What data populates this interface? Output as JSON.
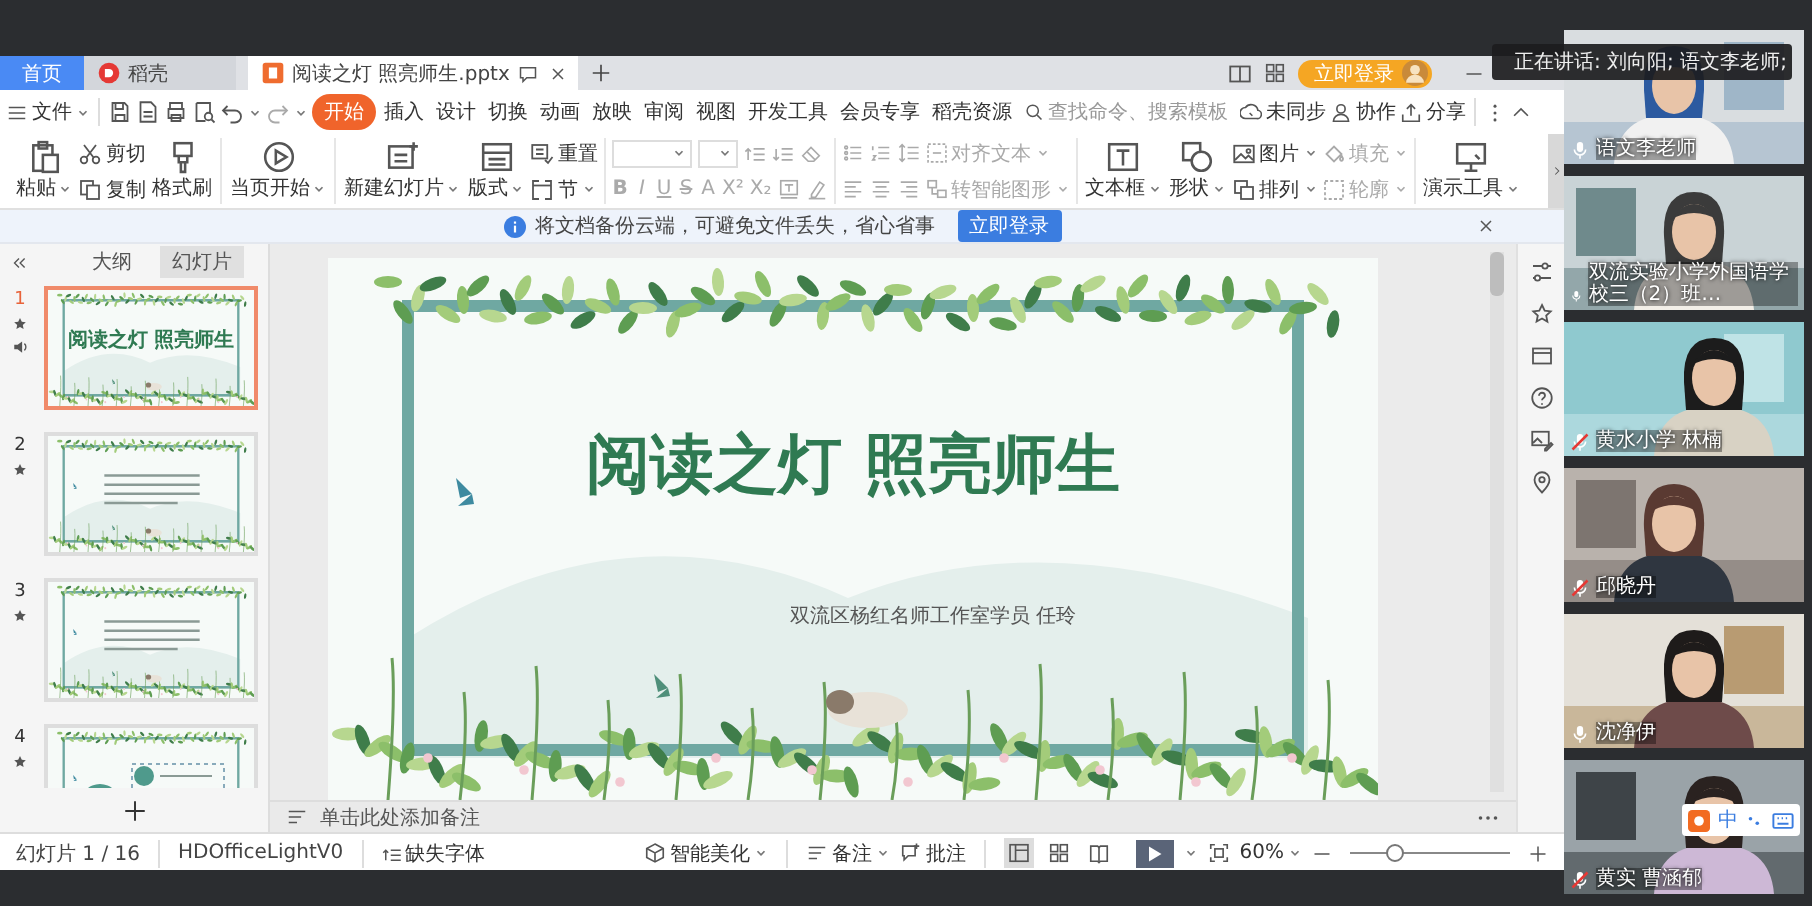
{
  "app_tabs": [
    {
      "label": "首页",
      "kind": "home",
      "selected": false
    },
    {
      "label": "稻壳",
      "kind": "store",
      "selected": false
    },
    {
      "label": "阅读之灯 照亮师生.pptx",
      "kind": "document",
      "selected": true
    }
  ],
  "account": {
    "login": "立即登录"
  },
  "menu": {
    "file": "文件",
    "tabs": [
      {
        "label": "开始",
        "selected": true
      },
      {
        "label": "插入",
        "selected": false
      },
      {
        "label": "设计",
        "selected": false
      },
      {
        "label": "切换",
        "selected": false
      },
      {
        "label": "动画",
        "selected": false
      },
      {
        "label": "放映",
        "selected": false
      },
      {
        "label": "审阅",
        "selected": false
      },
      {
        "label": "视图",
        "selected": false
      },
      {
        "label": "开发工具",
        "selected": false
      },
      {
        "label": "会员专享",
        "selected": false
      },
      {
        "label": "稻壳资源",
        "selected": false
      }
    ],
    "search": {
      "placeholder": "查找命令、搜索模板"
    },
    "actions": [
      {
        "label": "未同步",
        "kind": "sync"
      },
      {
        "label": "协作",
        "kind": "collab"
      },
      {
        "label": "分享",
        "kind": "share"
      }
    ]
  },
  "ribbon": [
    {
      "columns": [
        {
          "kind": "large",
          "label": "粘贴",
          "dropdown": true
        },
        {
          "kind": "stack",
          "items": [
            {
              "label": "剪切"
            },
            {
              "label": "复制"
            }
          ]
        },
        {
          "kind": "large",
          "label": "格式刷"
        }
      ]
    },
    {
      "columns": [
        {
          "kind": "large",
          "label": "当页开始",
          "dropdown": true
        }
      ]
    },
    {
      "columns": [
        {
          "kind": "large",
          "label": "新建幻灯片",
          "dropdown": true
        },
        {
          "kind": "large",
          "label": "版式",
          "dropdown": true
        },
        {
          "kind": "stack",
          "items": [
            {
              "label": "重置"
            },
            {
              "label": "节",
              "dropdown": true
            }
          ]
        }
      ]
    },
    {
      "columns": [
        {
          "kind": "font",
          "glyphs": [
            "B",
            "I",
            "U",
            "S",
            "A",
            "X²",
            "X₂"
          ]
        }
      ]
    },
    {
      "columns": [
        {
          "kind": "paragraph",
          "labels": [
            {
              "label": "对齐文本",
              "disabled": true
            },
            {
              "label": "转智能图形",
              "disabled": true
            }
          ]
        }
      ]
    },
    {
      "columns": [
        {
          "kind": "large",
          "label": "文本框",
          "dropdown": true
        },
        {
          "kind": "large",
          "label": "形状",
          "dropdown": true
        },
        {
          "kind": "stack",
          "items": [
            {
              "label": "图片",
              "dropdown": true
            },
            {
              "label": "排列",
              "dropdown": true
            }
          ]
        },
        {
          "kind": "stack",
          "items": [
            {
              "label": "填充",
              "dropdown": true,
              "disabled": true
            },
            {
              "label": "轮廓",
              "dropdown": true,
              "disabled": true
            }
          ]
        }
      ]
    },
    {
      "columns": [
        {
          "kind": "large",
          "label": "演示工具",
          "dropdown": true
        }
      ]
    }
  ],
  "notice": {
    "text": "将文档备份云端，可避免文件丢失，省心省事",
    "button": "立即登录"
  },
  "panel": {
    "tabs": [
      {
        "label": "大纲",
        "selected": false
      },
      {
        "label": "幻灯片",
        "selected": true
      }
    ],
    "slides": [
      {
        "number": "1",
        "kind": "title",
        "title": "阅读之灯 照亮师生",
        "selected": true,
        "audio": true
      },
      {
        "number": "2",
        "kind": "text",
        "selected": false,
        "audio": false
      },
      {
        "number": "3",
        "kind": "text",
        "selected": false,
        "audio": false
      },
      {
        "number": "4",
        "kind": "diagram",
        "selected": false,
        "audio": false
      }
    ]
  },
  "slide": {
    "title": "阅读之灯 照亮师生",
    "subtitle": "双流区杨红名师工作室学员 任玲"
  },
  "notes": {
    "placeholder": "单击此处添加备注"
  },
  "status_bar": {
    "slide_count": "幻灯片 1 / 16",
    "theme": "HDOfficeLightV0",
    "missing_font": "缺失字体",
    "beautify": "智能美化",
    "notes": "备注",
    "comments": "批注",
    "views": [
      {
        "kind": "normal",
        "selected": true
      },
      {
        "kind": "sorter",
        "selected": false
      },
      {
        "kind": "reading",
        "selected": false
      }
    ],
    "zoom": "60%",
    "zoom_slider": {
      "level": 0.28
    }
  },
  "speaking": "正在讲话: 刘向阳; 语文李老师;",
  "participants": [
    {
      "name": "语文李老师",
      "muted": false
    },
    {
      "name": "双流实验小学外国语学校三（2）班…",
      "muted": false
    },
    {
      "name": "黄水小学 林楠",
      "muted": true
    },
    {
      "name": "邱晓丹",
      "muted": true
    },
    {
      "name": "沈净伊",
      "muted": false
    },
    {
      "name": "黄实 曹涵郁",
      "muted": true
    }
  ],
  "ime": {
    "mode": "中"
  }
}
